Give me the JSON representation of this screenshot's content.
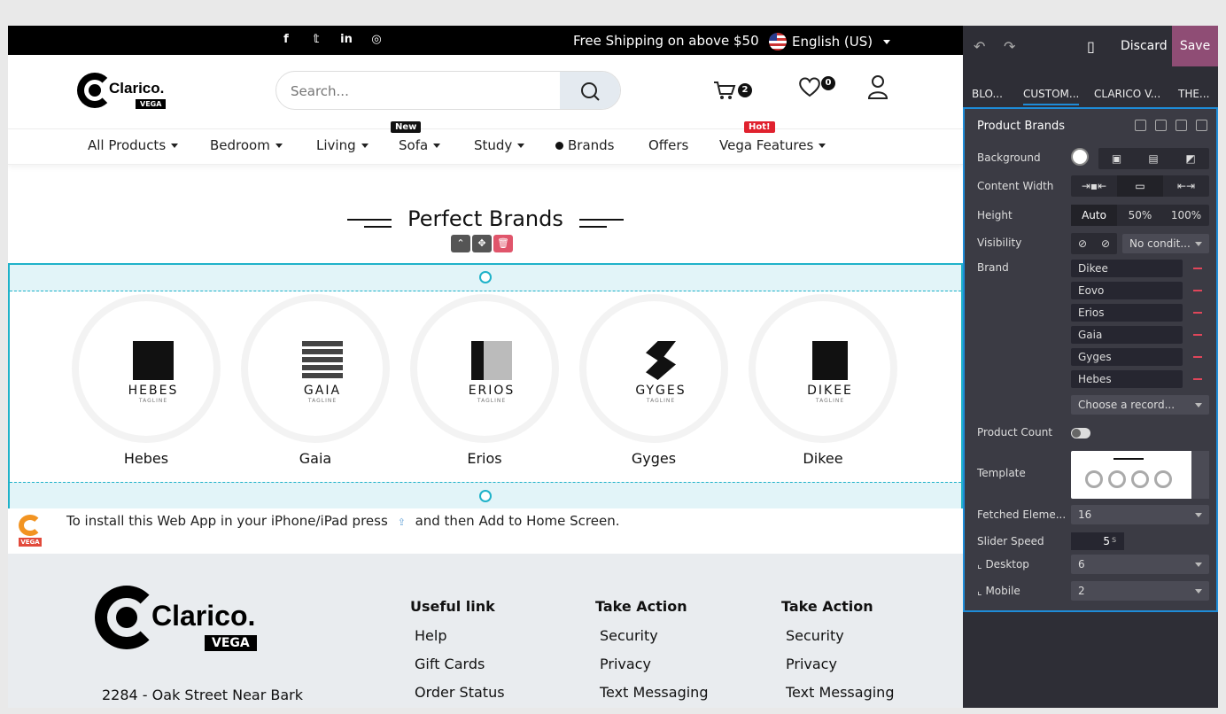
{
  "topbar": {
    "shipping": "Free Shipping on above $50",
    "language": "English (US)",
    "social_icons": [
      "facebook-icon",
      "twitter-icon",
      "linkedin-icon",
      "instagram-icon"
    ]
  },
  "header": {
    "logo_word": "Clarico.",
    "logo_sub": "VEGA",
    "search_placeholder": "Search...",
    "cart_count": "2",
    "wishlist_count": "0"
  },
  "nav": {
    "items": [
      "All Products",
      "Bedroom",
      "Living",
      "Sofa",
      "Study",
      "Brands",
      "Offers",
      "Vega Features"
    ],
    "badge_new": "New",
    "badge_hot": "Hot!"
  },
  "section": {
    "title": "Perfect Brands",
    "brands": [
      {
        "name": "Hebes",
        "logo": "HEBES",
        "tagline": "TAGLINE"
      },
      {
        "name": "Gaia",
        "logo": "GAIA",
        "tagline": "TAGLINE"
      },
      {
        "name": "Erios",
        "logo": "ERIOS",
        "tagline": "TAGLINE"
      },
      {
        "name": "Gyges",
        "logo": "GYGES",
        "tagline": "TAGLINE"
      },
      {
        "name": "Dikee",
        "logo": "DIKEE",
        "tagline": "TAGLINE"
      }
    ]
  },
  "install": {
    "text_before": "To install this Web App in your iPhone/iPad press",
    "text_after": "and then Add to Home Screen.",
    "icon_label": "VEGA"
  },
  "footer": {
    "logo_word": "Clarico.",
    "logo_sub": "VEGA",
    "address": "2284 - Oak Street Near Bark",
    "columns": [
      {
        "title": "Useful link",
        "links": [
          "Help",
          "Gift Cards",
          "Order Status"
        ]
      },
      {
        "title": "Take Action",
        "links": [
          "Security",
          "Privacy",
          "Text Messaging"
        ]
      },
      {
        "title": "Take Action",
        "links": [
          "Security",
          "Privacy",
          "Text Messaging"
        ]
      }
    ]
  },
  "editor": {
    "discard": "Discard",
    "save": "Save",
    "tabs": [
      "BLO...",
      "CUSTOM...",
      "CLARICO V...",
      "THE..."
    ],
    "section_title": "Product Brands",
    "labels": {
      "background": "Background",
      "content_width": "Content Width",
      "height": "Height",
      "visibility": "Visibility",
      "brand": "Brand",
      "product_count": "Product Count",
      "template": "Template",
      "fetched": "Fetched Eleme...",
      "slider_speed": "Slider Speed",
      "desktop": "⌞ Desktop",
      "mobile": "⌞ Mobile"
    },
    "height_options": [
      "Auto",
      "50%",
      "100%"
    ],
    "visibility_value": "No condit...",
    "brand_records": [
      "Dikee",
      "Eovo",
      "Erios",
      "Gaia",
      "Gyges",
      "Hebes"
    ],
    "choose_record": "Choose a record...",
    "fetched_value": "16",
    "slider_speed_value": "5",
    "slider_speed_unit": "s",
    "desktop_value": "6",
    "mobile_value": "2",
    "accent": "#1e8cd8",
    "save_color": "#8f4d75"
  }
}
